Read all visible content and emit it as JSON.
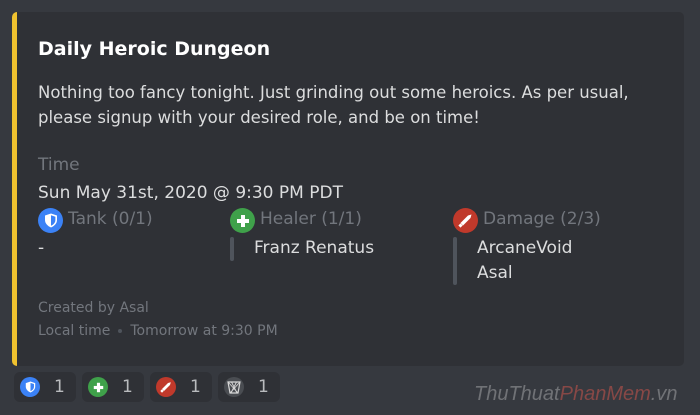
{
  "embed": {
    "accent_color": "#f0c22f",
    "title": "Daily Heroic Dungeon",
    "description": "Nothing too fancy tonight. Just grinding out some heroics. As per usual, please signup with your desired role, and be on time!",
    "time_label": "Time",
    "time_value": "Sun May 31st, 2020 @ 9:30 PM PDT",
    "roles": [
      {
        "icon": "shield-icon",
        "color": "#3b82f6",
        "label": "Tank (0/1)",
        "empty": "-",
        "members": []
      },
      {
        "icon": "plus-icon",
        "color": "#3fa14a",
        "label": "Healer (1/1)",
        "members": [
          "Franz Renatus"
        ]
      },
      {
        "icon": "sword-icon",
        "color": "#c0392b",
        "label": "Damage (2/3)",
        "members": [
          "ArcaneVoid",
          "Asal"
        ]
      }
    ],
    "footer": {
      "created_by": "Created by Asal",
      "local_time_label": "Local time",
      "local_time_value": "Tomorrow at 9:30 PM"
    }
  },
  "reactions": [
    {
      "icon": "shield-icon",
      "count": "1"
    },
    {
      "icon": "plus-icon",
      "count": "1"
    },
    {
      "icon": "sword-icon",
      "count": "1"
    },
    {
      "icon": "basket-icon",
      "count": "1"
    }
  ],
  "watermark": {
    "part1": "ThuThuat",
    "part2": "PhanMem",
    "part3": ".vn"
  }
}
